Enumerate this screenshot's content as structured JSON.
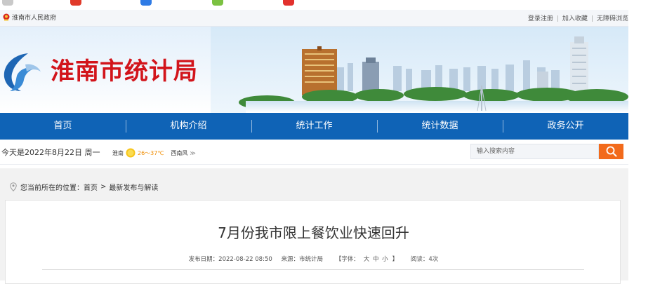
{
  "top": {
    "gov_name": "淮南市人民政府",
    "links": [
      "登录注册",
      "加入收藏",
      "无障碍浏览"
    ]
  },
  "banner": {
    "title": "淮南市统计局"
  },
  "nav": {
    "items": [
      "首页",
      "机构介绍",
      "统计工作",
      "统计数据",
      "政务公开"
    ]
  },
  "info": {
    "date": "今天是2022年8月22日 周一",
    "city": "淮南",
    "temp": "26～37℃",
    "wind": "西南风",
    "more": "≫",
    "search_placeholder": "输入搜索内容"
  },
  "breadcrumb": {
    "prefix": "您当前所在的位置：",
    "home": "首页",
    "sep": ">",
    "section": "最新发布与解读"
  },
  "article": {
    "title": "7月份我市限上餐饮业快速回升",
    "publish": "发布日期：2022-08-22 08:50",
    "source": "来源：市统计局",
    "font_open": "【字体：",
    "font_sizes": [
      "大",
      "中",
      "小"
    ],
    "font_close": "】",
    "views": "阅读：4次"
  },
  "colors": {
    "brand_red": "#d2141b",
    "nav_blue": "#0f63b6",
    "search_orange": "#f26a1b"
  }
}
